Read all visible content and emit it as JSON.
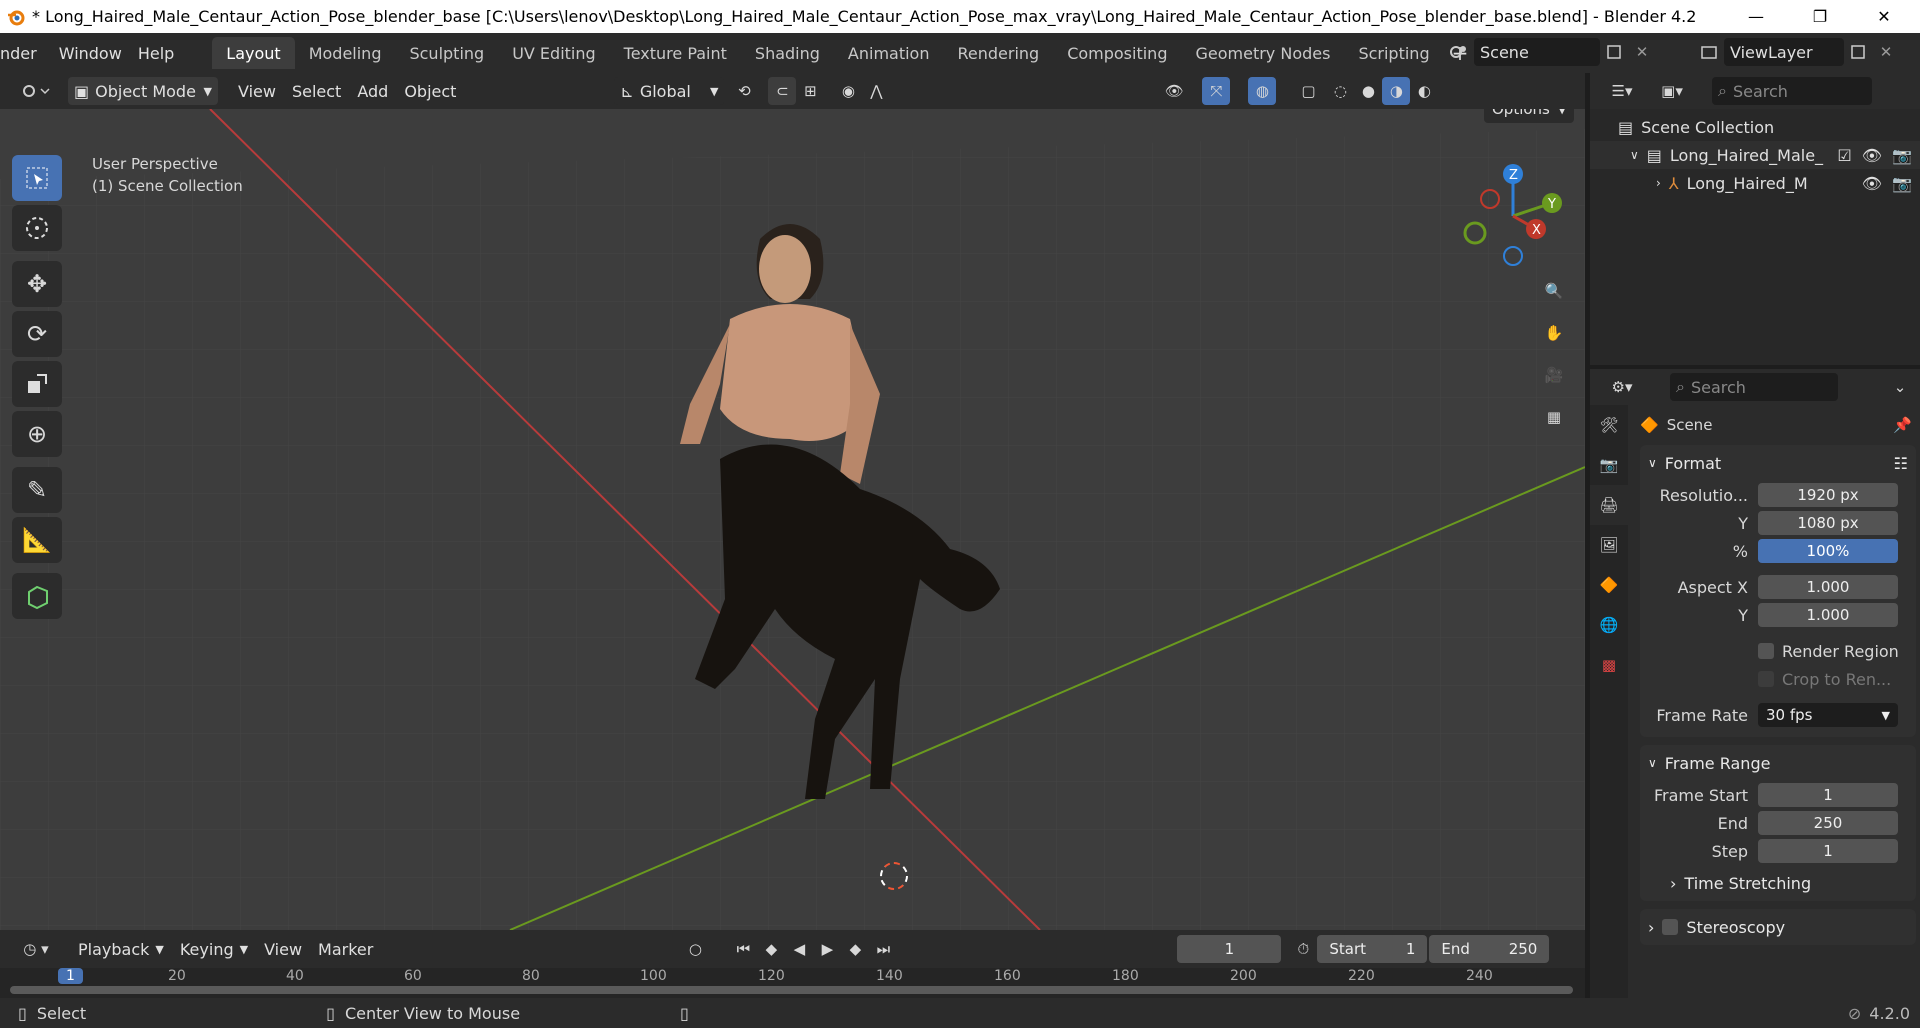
{
  "title_bar": {
    "title": "* Long_Haired_Male_Centaur_Action_Pose_blender_base [C:\\Users\\lenov\\Desktop\\Long_Haired_Male_Centaur_Action_Pose_max_vray\\Long_Haired_Male_Centaur_Action_Pose_blender_base.blend] - Blender 4.2",
    "minimize": "—",
    "maximize": "❐",
    "close": "✕"
  },
  "menu": {
    "items": [
      "nder",
      "Window",
      "Help"
    ],
    "workspaces": [
      "Layout",
      "Modeling",
      "Sculpting",
      "UV Editing",
      "Texture Paint",
      "Shading",
      "Animation",
      "Rendering",
      "Compositing",
      "Geometry Nodes",
      "Scripting"
    ],
    "add_workspace": "+",
    "scene_name": "Scene",
    "view_layer": "ViewLayer"
  },
  "viewport_header": {
    "mode": "Object Mode",
    "menus": [
      "View",
      "Select",
      "Add",
      "Object"
    ],
    "orientation": "Global",
    "options": "Options"
  },
  "viewport": {
    "overlay_line1": "User Perspective",
    "overlay_line2": "(1) Scene Collection",
    "gizmo": {
      "z": "Z",
      "y": "Y",
      "x": "X"
    }
  },
  "outliner": {
    "search_placeholder": "Search",
    "root": "Scene Collection",
    "rows": [
      {
        "label": "Long_Haired_Male_"
      },
      {
        "label": "Long_Haired_M"
      }
    ]
  },
  "properties": {
    "search_placeholder": "Search",
    "context": "Scene",
    "format": {
      "title": "Format",
      "resolution_x_label": "Resolutio...",
      "resolution_x": "1920 px",
      "resolution_y_label": "Y",
      "resolution_y": "1080 px",
      "percent_label": "%",
      "percent": "100%",
      "aspect_x_label": "Aspect X",
      "aspect_x": "1.000",
      "aspect_y_label": "Y",
      "aspect_y": "1.000",
      "render_region": "Render Region",
      "crop": "Crop to Ren...",
      "frame_rate_label": "Frame Rate",
      "frame_rate": "30 fps"
    },
    "frame_range": {
      "title": "Frame Range",
      "start_label": "Frame Start",
      "start": "1",
      "end_label": "End",
      "end": "250",
      "step_label": "Step",
      "step": "1"
    },
    "time_stretching": "Time Stretching",
    "stereoscopy": "Stereoscopy"
  },
  "timeline": {
    "menus": [
      "Playback",
      "Keying",
      "View",
      "Marker"
    ],
    "current_frame": "1",
    "start_label": "Start",
    "start": "1",
    "end_label": "End",
    "end": "250",
    "ticks": [
      "1",
      "20",
      "40",
      "60",
      "80",
      "100",
      "120",
      "140",
      "160",
      "180",
      "200",
      "220",
      "240"
    ]
  },
  "status_bar": {
    "select": "Select",
    "center_view": "Center View to Mouse",
    "version": "4.2.0"
  },
  "colors": {
    "accent": "#4772b3",
    "x_axis": "#c0392b",
    "y_axis": "#6a9a1f",
    "z_axis": "#2f80d9"
  }
}
